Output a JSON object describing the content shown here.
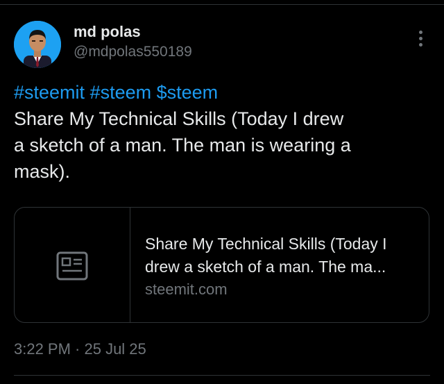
{
  "user": {
    "display_name": "md polas",
    "handle": "@mdpolas550189",
    "avatar": "profile-photo"
  },
  "post": {
    "hashtags": [
      "#steemit",
      "#steem",
      "$steem"
    ],
    "text_line_1": "Share My Technical Skills (Today I drew",
    "text_line_2": "a sketch of a man. The man is wearing a",
    "text_line_3": "mask)."
  },
  "link_card": {
    "icon": "article-icon",
    "title_line_1": "Share My Technical Skills (Today I",
    "title_line_2": "drew a sketch of a man. The ma...",
    "domain": "steemit.com"
  },
  "meta": {
    "timestamp": "3:22 PM · 25 Jul 25"
  },
  "menu": {
    "icon": "more-vertical-icon"
  },
  "colors": {
    "background": "#000000",
    "text": "#e7e9ea",
    "secondary": "#71767b",
    "accent": "#1d9bf0",
    "border": "#2f3336"
  }
}
